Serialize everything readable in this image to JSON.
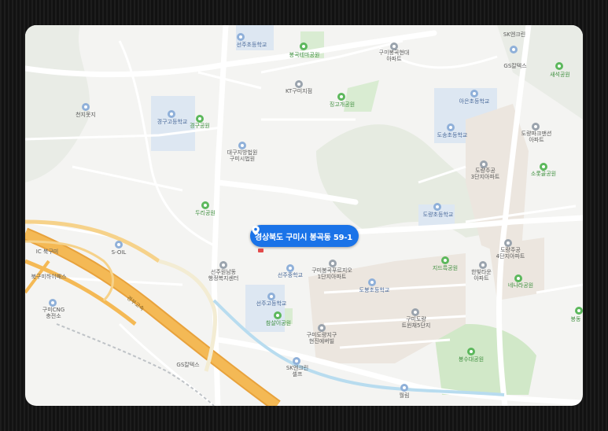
{
  "marker": {
    "address": "경상북도 구미시 봉곡동 59-1",
    "icon": "location-pin-icon",
    "color": "#1a73e8"
  },
  "labels": [
    {
      "id": "seonju-elem",
      "text": "선주초등학교",
      "kind": "school"
    },
    {
      "id": "bonggok-theme-park",
      "text": "봉곡테마공원",
      "kind": "park"
    },
    {
      "id": "gumi-bonggok-hyundai",
      "text": "구미봉곡현대\n아파트",
      "kind": "place"
    },
    {
      "id": "sk-charger-top",
      "text": "SK엔크린",
      "kind": "place"
    },
    {
      "id": "gs-top",
      "text": "GS칼텍스",
      "kind": "place"
    },
    {
      "id": "saeseok-park",
      "text": "새석공원",
      "kind": "park"
    },
    {
      "id": "kt-gumi",
      "text": "KT구미지점",
      "kind": "place"
    },
    {
      "id": "jinggo-park",
      "text": "징고개공원",
      "kind": "park"
    },
    {
      "id": "arun-elem",
      "text": "아은초등학교",
      "kind": "school"
    },
    {
      "id": "cheonji-pond",
      "text": "천지못지",
      "kind": "place"
    },
    {
      "id": "gyeonggu-high",
      "text": "경구고등학교",
      "kind": "school"
    },
    {
      "id": "gyeonggu-park",
      "text": "경구공원",
      "kind": "park"
    },
    {
      "id": "dosong-elem",
      "text": "도송초등학교",
      "kind": "school"
    },
    {
      "id": "dorang-park-mansion",
      "text": "도량파크맨션\n아파트",
      "kind": "place"
    },
    {
      "id": "court",
      "text": "대구지방법원\n구미시법원",
      "kind": "place"
    },
    {
      "id": "dorang-jugong3",
      "text": "도량주공\n3단지아파트",
      "kind": "place"
    },
    {
      "id": "sorok-park",
      "text": "소롯골공원",
      "kind": "park"
    },
    {
      "id": "dorang-elem",
      "text": "도량초등학교",
      "kind": "school"
    },
    {
      "id": "duri-park",
      "text": "두리공원",
      "kind": "park"
    },
    {
      "id": "soil",
      "text": "S-OIL",
      "kind": "place"
    },
    {
      "id": "bukgumi-ic",
      "text": "IC 북구미",
      "kind": "place"
    },
    {
      "id": "bukgumi-hipass",
      "text": "북구미하이패스",
      "kind": "place"
    },
    {
      "id": "admin-center",
      "text": "선주원남동\n행정복지센터",
      "kind": "place"
    },
    {
      "id": "seonju-middle",
      "text": "선주중학교",
      "kind": "school"
    },
    {
      "id": "bonggok-prugio",
      "text": "구미봉곡푸르지오\n1단지아파트",
      "kind": "place"
    },
    {
      "id": "jidoreuk-park",
      "text": "지드륵공원",
      "kind": "park"
    },
    {
      "id": "dorang-jugong4",
      "text": "도량주공\n4단지아파트",
      "kind": "place"
    },
    {
      "id": "hanbit-town",
      "text": "한빛타운\n아파트",
      "kind": "place"
    },
    {
      "id": "nenara-park",
      "text": "네나라공원",
      "kind": "park"
    },
    {
      "id": "dobong-elem",
      "text": "도봉초등학교",
      "kind": "school"
    },
    {
      "id": "gumi-cng",
      "text": "구미CNG\n충전소",
      "kind": "place"
    },
    {
      "id": "seonju-high",
      "text": "선주고등학교",
      "kind": "school"
    },
    {
      "id": "chamsari-park",
      "text": "참살이공원",
      "kind": "park"
    },
    {
      "id": "dorang-town5",
      "text": "구미도량\n트윈채5단지",
      "kind": "place"
    },
    {
      "id": "dorang-district",
      "text": "구미도량지구\n현진에버빌",
      "kind": "place"
    },
    {
      "id": "bongsudae-park",
      "text": "봉수대공원",
      "kind": "park"
    },
    {
      "id": "gyeongbu-expressway",
      "text": "경부고속",
      "kind": "road"
    },
    {
      "id": "gs-bottom",
      "text": "GS칼텍스",
      "kind": "place"
    },
    {
      "id": "sk-enclean-self",
      "text": "SK엔크린\n셀프",
      "kind": "place"
    },
    {
      "id": "wolrim",
      "text": "월림",
      "kind": "place"
    },
    {
      "id": "bonggok-edge",
      "text": "봉동",
      "kind": "place"
    }
  ]
}
